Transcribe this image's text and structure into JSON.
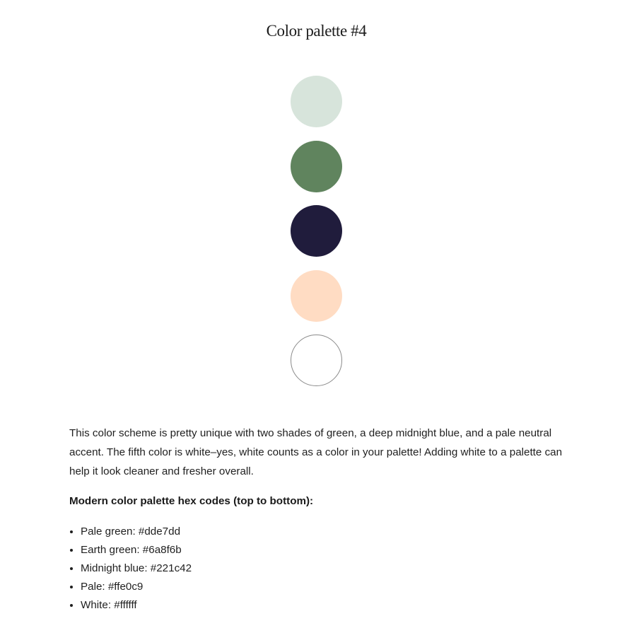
{
  "page": {
    "title": "Color palette #4"
  },
  "swatches": [
    {
      "name": "Pale green",
      "color": "#d7e4db"
    },
    {
      "name": "Earth green",
      "color": "#60845e"
    },
    {
      "name": "Midnight blue",
      "color": "#201c3c"
    },
    {
      "name": "Pale",
      "color": "#ffdcc3"
    },
    {
      "name": "White",
      "color": "#ffffff"
    }
  ],
  "description": "This color scheme is pretty unique with two shades of green, a deep midnight blue, and a pale neutral accent. The fifth color is white–yes, white counts as a color in your palette! Adding white to a palette can help it look cleaner and fresher overall.",
  "hex_section": {
    "heading": "Modern color palette hex codes (top to bottom):",
    "items": [
      "Pale green: #dde7dd",
      "Earth green: #6a8f6b",
      "Midnight blue: #221c42",
      "Pale: #ffe0c9",
      "White: #ffffff"
    ]
  }
}
